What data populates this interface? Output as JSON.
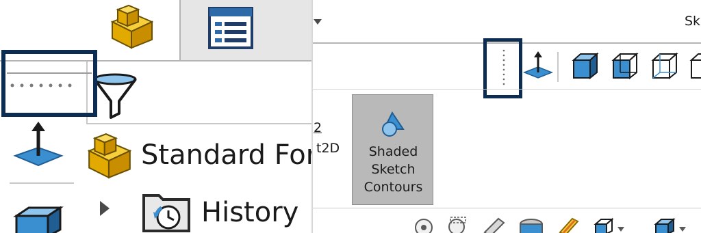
{
  "left_panel": {
    "tabs": [
      {
        "name": "FeatureManager design tree",
        "icon": "part-icon"
      },
      {
        "name": "PropertyManager",
        "icon": "property-manager-icon"
      }
    ],
    "filter_icon": "filter-icon",
    "tree": [
      {
        "label": "Standard For",
        "icon": "part-icon"
      },
      {
        "label": "History",
        "icon": "history-folder-icon"
      }
    ]
  },
  "right_panel": {
    "header_cut_text": "Sk",
    "view_toolbar_icons": [
      "normal-to-icon",
      "shaded-with-edges-icon",
      "shaded-icon",
      "hidden-lines-removed-icon",
      "wireframe-icon"
    ],
    "sketch_cut_fragment_top": "2",
    "sketch_cut_fragment": "t2D",
    "shaded_sketch_contours": {
      "line1": "Shaded",
      "line2": "Sketch",
      "line3": "Contours"
    },
    "bottom_toolbar_icons": [
      "zoom-to-fit-icon",
      "zoom-area-icon",
      "previous-view-icon",
      "section-view-icon",
      "dynamic-annotation-icon",
      "view-orientation-icon",
      "display-style-icon"
    ]
  },
  "colors": {
    "highlight": "#0c2c52",
    "icon_yellow": "#e8b400",
    "icon_blue": "#3a8fd0",
    "button_gray": "#b9b9b9"
  }
}
